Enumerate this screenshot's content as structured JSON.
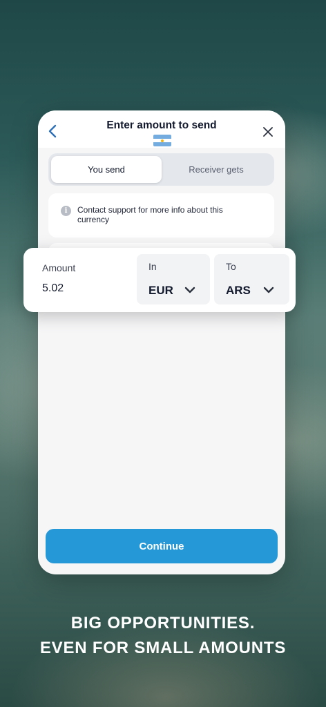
{
  "header": {
    "title": "Enter amount to send",
    "back_icon": "chevron-left-icon",
    "close_icon": "close-icon",
    "flag": "argentina-flag"
  },
  "toggle": {
    "tabs": [
      {
        "label": "You send",
        "active": true
      },
      {
        "label": "Receiver gets",
        "active": false
      }
    ]
  },
  "info": {
    "icon": "info-icon",
    "icon_glyph": "i",
    "text": "Contact support for more info about this currency"
  },
  "amount_panel": {
    "amount_label": "Amount",
    "amount_value": "5.02",
    "in_label": "In",
    "in_currency": "EUR",
    "to_label": "To",
    "to_currency": "ARS"
  },
  "continue_label": "Continue",
  "headline": {
    "line1": "BIG OPPORTUNITIES.",
    "line2": "EVEN FOR SMALL AMOUNTS"
  },
  "colors": {
    "accent": "#2598d8",
    "card_bg": "#f6f6f7",
    "text_dark": "#141a2e"
  }
}
